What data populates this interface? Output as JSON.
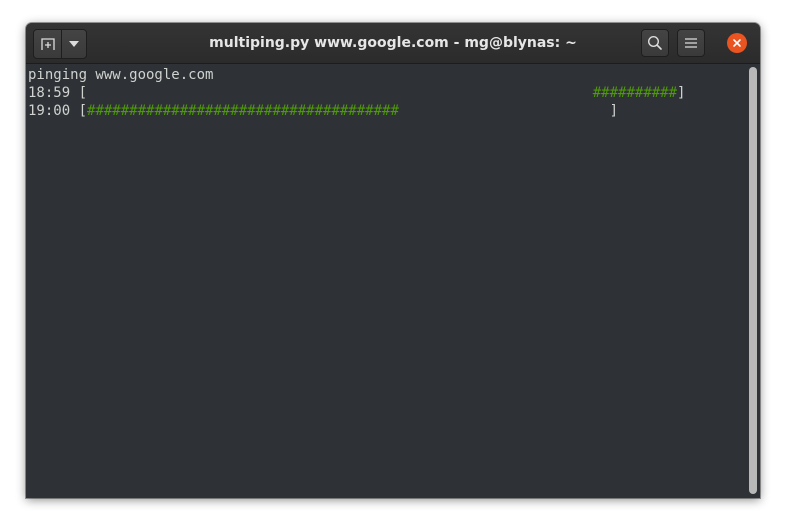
{
  "window": {
    "title": "multiping.py www.google.com - mg@blynas: ~"
  },
  "headerbar": {
    "new_tab_icon": "new-tab-icon",
    "dropdown_icon": "chevron-down-icon",
    "search_icon": "search-icon",
    "menu_icon": "hamburger-menu-icon",
    "close_icon": "close-icon"
  },
  "colors": {
    "close_button": "#e95420",
    "terminal_bg": "#2e3236",
    "text": "#d0d2cf",
    "ping_bar": "#4e9a06"
  },
  "terminal": {
    "line1": "pinging www.google.com",
    "row1": {
      "time": "18:59",
      "open": " [",
      "pad": "                                                            ",
      "bar": "##########",
      "close": "]"
    },
    "row2": {
      "time": "19:00",
      "open": " [",
      "bar": "#####################################",
      "pad": "                         ",
      "close": "]"
    }
  }
}
